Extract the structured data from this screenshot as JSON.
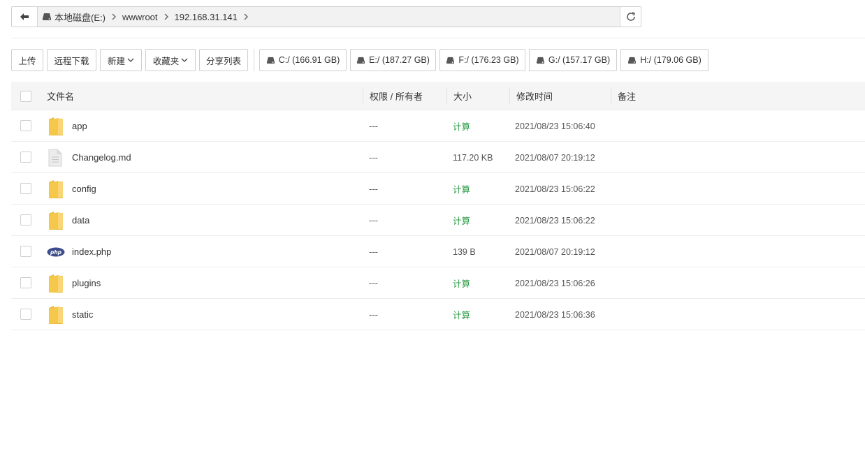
{
  "pathbar": {
    "crumbs": [
      "本地磁盘(E:)",
      "wwwroot",
      "192.168.31.141"
    ]
  },
  "toolbar": {
    "upload": "上传",
    "remote_download": "远程下载",
    "new": "新建",
    "favorites": "收藏夹",
    "share_list": "分享列表",
    "drives": [
      "C:/ (166.91 GB)",
      "E:/ (187.27 GB)",
      "F:/ (176.23 GB)",
      "G:/ (157.17 GB)",
      "H:/ (179.06 GB)"
    ]
  },
  "table": {
    "headers": {
      "name": "文件名",
      "perm": "权限 / 所有者",
      "size": "大小",
      "mtime": "修改时间",
      "note": "备注"
    },
    "rows": [
      {
        "icon": "folder-icon",
        "name": "app",
        "perm": "---",
        "size": "计算",
        "mtime": "2021/08/23 15:06:40"
      },
      {
        "icon": "file-icon",
        "name": "Changelog.md",
        "perm": "---",
        "size": "117.20 KB",
        "mtime": "2021/08/07 20:19:12"
      },
      {
        "icon": "folder-icon",
        "name": "config",
        "perm": "---",
        "size": "计算",
        "mtime": "2021/08/23 15:06:22"
      },
      {
        "icon": "folder-icon",
        "name": "data",
        "perm": "---",
        "size": "计算",
        "mtime": "2021/08/23 15:06:22"
      },
      {
        "icon": "php-icon",
        "name": "index.php",
        "perm": "---",
        "size": "139 B",
        "mtime": "2021/08/07 20:19:12"
      },
      {
        "icon": "folder-icon",
        "name": "plugins",
        "perm": "---",
        "size": "计算",
        "mtime": "2021/08/23 15:06:26"
      },
      {
        "icon": "folder-icon",
        "name": "static",
        "perm": "---",
        "size": "计算",
        "mtime": "2021/08/23 15:06:36"
      }
    ]
  },
  "colors": {
    "calc_link": "#2e9b47",
    "folder": "#f5c84c",
    "php_badge": "#3d4d8a"
  },
  "icon_php_text": "php"
}
